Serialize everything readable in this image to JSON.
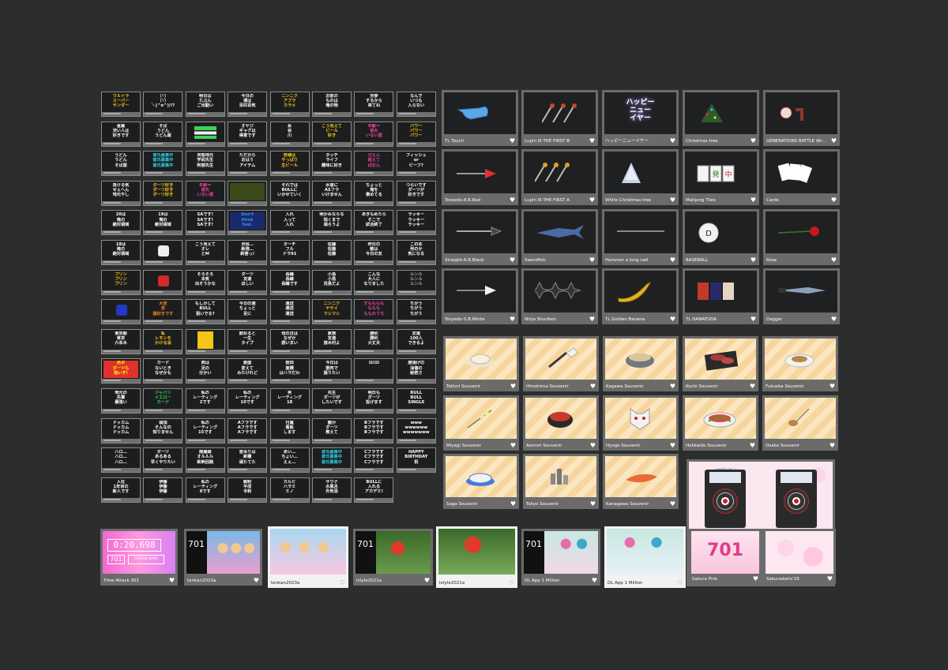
{
  "message_stamps": [
    [
      "ウルトラ\nスーパー\nサンダー",
      "（∵）\n（∵）\n＼(^o^)/!?",
      "明日は\nたぶん\nご出勤い",
      "今日の\n運は\n百匹百気",
      "ニンニク\nアブラ\nカラメ",
      "お前の\nものは\n俺の物",
      "労参\nするから\n来てね",
      "なんで\nいつも\n入らない"
    ],
    [
      "金属\n渋い人は\n好きです",
      "そば\nうどん\nうどん屋",
      "",
      "オヤジ\nギャグは\n得意です",
      "糸\n谷\n川",
      "こう見えて\nビール\n好き",
      "年齢＝\n彼女\nいない歴",
      "パワー\nパワー\nパワー"
    ],
    [
      "うどん\nうどん\nそば屋",
      "彼氏募集中\n彼氏募集中\n彼氏募集中",
      "貝殻地元\n学武先生\n阿部先生",
      "ただから\nおはう\nアイテム",
      "若様は\nやっぱり\n生ビール",
      "タッチ\nライフ\n趣味に好き",
      "ぴえん\n超えて\nぱおん",
      "フィッシュ\nor\nビーフ?"
    ],
    [
      "負ける気\nせぇへん\n地元やし",
      "ダーツ好き\nダーツ好き\nダーツ好き",
      "年齢＝\n彼氏\nいない歴",
      "",
      "それでは\nBULLに\nいかせていく",
      "水道に\nASフラ\nいけません",
      "ちょっと\n俺を\n褒めてる",
      "つらいです\nダーツが\n好きです"
    ],
    [
      "20は\n俺の\n絶対領域",
      "19は\n俺の\n絶対領域",
      "SAです!\nSAです!\nSAです!",
      "Don't\nthink\nfeel.",
      "入れ\n入って\n入れ",
      "明かみならな\n悩くまで\n頑ろうよ",
      "あきもめたら\nそこで\n試合終了",
      "ラッキー\nラッキー\nラッキー"
    ],
    [
      "18は\n俺の\n絶対領域",
      "",
      "こう見えて\nオレ\nとM",
      "渋谷…\n新宿…\n新宿っ!",
      "ターチ\nフル\nドラ91",
      "佐藤\n佐藤\n佐藤",
      "昨日の\n敵は\n今日の友",
      "この本\n何のか\n気になる"
    ],
    [
      "プリン\nプリン\nプリン",
      "",
      "そろそろ\n本気\n出そうかな",
      "ダーツ\n友達\nほしい",
      "長嶋\n長嶋\n長嶋です",
      "小島\n小島\n児島だよ",
      "こんな\n大人に\nなりました",
      "ルンル\nルンル\nルンル"
    ],
    [
      "",
      "大吉\n吉\n猫好きです",
      "もしかして\nBULL\n狙いでる?",
      "今日の運\nちょっと\n足に",
      "運送\n運送\n運送",
      "ニンニク\nヤサイ\nマシマシ",
      "すもももも\nももも\nもものうち",
      "ちがう\nちがう\nちがう"
    ],
    [
      "東京都\n東京\n六本木",
      "私\nレモンを\nかける派",
      "",
      "飲めると\n一生\nタイプ",
      "母の日は\nなぜか\n誘いまい",
      "家族\n友達\n旅木村よ",
      "勝利\n勝利\n大丈夫",
      "友達\n100人\nできるよ"
    ],
    [
      "赤ボ\nダーツも\n強いぞ!",
      "カード\nないとき\nなぜかも",
      "西は\n足の\n分かい",
      "髭面\n変えて\nみたけれど",
      "桂田\n面積\nはハラだわ",
      "今日は\n筋肉で\n語りたい",
      "⚄⚄⚄",
      "唐揚げの\n油傷の\n秘密さ"
    ],
    [
      "地元の\n先輩\n最強い",
      "ジャパン\nイエロー\nカード",
      "私の\nレーティング\n2です",
      "私の\nレーティング\n10です",
      "男\nレーティング\n18",
      "先生\nダーツが\nしたいです",
      "明日も\nダーツ\n投げます",
      "BULL\nBULL\nSINGLE"
    ],
    [
      "ドッカム\nドッカム\nドッカム",
      "頭頂\nそんなの\n知りません",
      "私の\nレーティング\n15です",
      "Aフラです\nAフラです\nAフラです",
      "付属\n看板\nします",
      "龍か\nダーツ\n教えて",
      "Bフラです\nBフラです\nBフラです",
      "www\nwwwwww\nwwwwwww"
    ],
    [
      "ハロ…\nハロ…\nハロ…",
      "ダーツ\nあるある\n早くやりたい",
      "階層線\nオルルル\n新幹回路",
      "首吊りは\n新種\n頑たてた",
      "あい…\nちょい…\nえぇ…",
      "彼氏募集中\n彼氏募集中\n彼氏募集中",
      "Cフラです\nCフラです\nCフラです",
      "HAPPY\nBIRTHDAY\n祝"
    ],
    [
      "入社\n1年目の\n新人です",
      "伊藤\n伊藤\n伊藤",
      "私の\nレーティング\n8です",
      "駒粉\n平成\n令和",
      "カルビ\nハラミ\nミノ",
      "サウナ\n水風呂\n外気浴",
      "BULLに\n入れる\nアカデミ!",
      null
    ]
  ],
  "item_rows": [
    [
      "TL Touch",
      "Lupin III THE FIRST B",
      "ハッピーニューイヤー",
      "Christmas tree",
      "GENERATIONS BATTLE Wi-..."
    ],
    [
      "Torpedo-A.R.Red",
      "Lupin III THE FIRST A",
      "White Christmas tree",
      "Mahjong Tiles",
      "Cards"
    ],
    [
      "Straight-A.B.Black",
      "Swordfish",
      "Hammer a long nail",
      "BASEBALL",
      "Rose"
    ],
    [
      "Torpedo-S.B.White",
      "Ninja Shuriken",
      "TL Golden Banana",
      "TL HANAFUDA",
      "Dagger"
    ]
  ],
  "souvenir_rows": [
    [
      "Tottori Souvenir",
      "Hiroshima Souvenir",
      "Kagawa Souvenir",
      "Kochi Souvenir",
      "Fukuoka Souvenir"
    ],
    [
      "Miyagi Souvenir",
      "Aomori Souvenir",
      "Hyogo Souvenir",
      "Hokkaido Souvenir",
      "Osaka Souvenir"
    ],
    [
      "Saga Souvenir",
      "Tokyo Souvenir",
      "Kanagawa Souvenir"
    ]
  ],
  "neon_text": "ハッピー\nニュー\nイヤー",
  "baseball_letter": "D",
  "sakura": {
    "top_label": "DARTSLIVE 3",
    "pink_number": "701",
    "cards": [
      "Sakura Pink",
      "Sakuradarts'19"
    ]
  },
  "themes": [
    {
      "label": "Time Attack 301",
      "timer": "0:20.698",
      "score": "701",
      "button": "THROW DART"
    },
    {
      "label": "tenkan2023a",
      "number": "701"
    },
    {
      "label": "tenkan2023a"
    },
    {
      "label": "lstyle2021a",
      "number": "701"
    },
    {
      "label": "lstyle2021a"
    },
    {
      "label": "DL App 1 Million",
      "number": "701"
    },
    {
      "label": "DL App 1 Million"
    }
  ],
  "heart_glyph": "♥",
  "heart_outline_glyph": "♡"
}
